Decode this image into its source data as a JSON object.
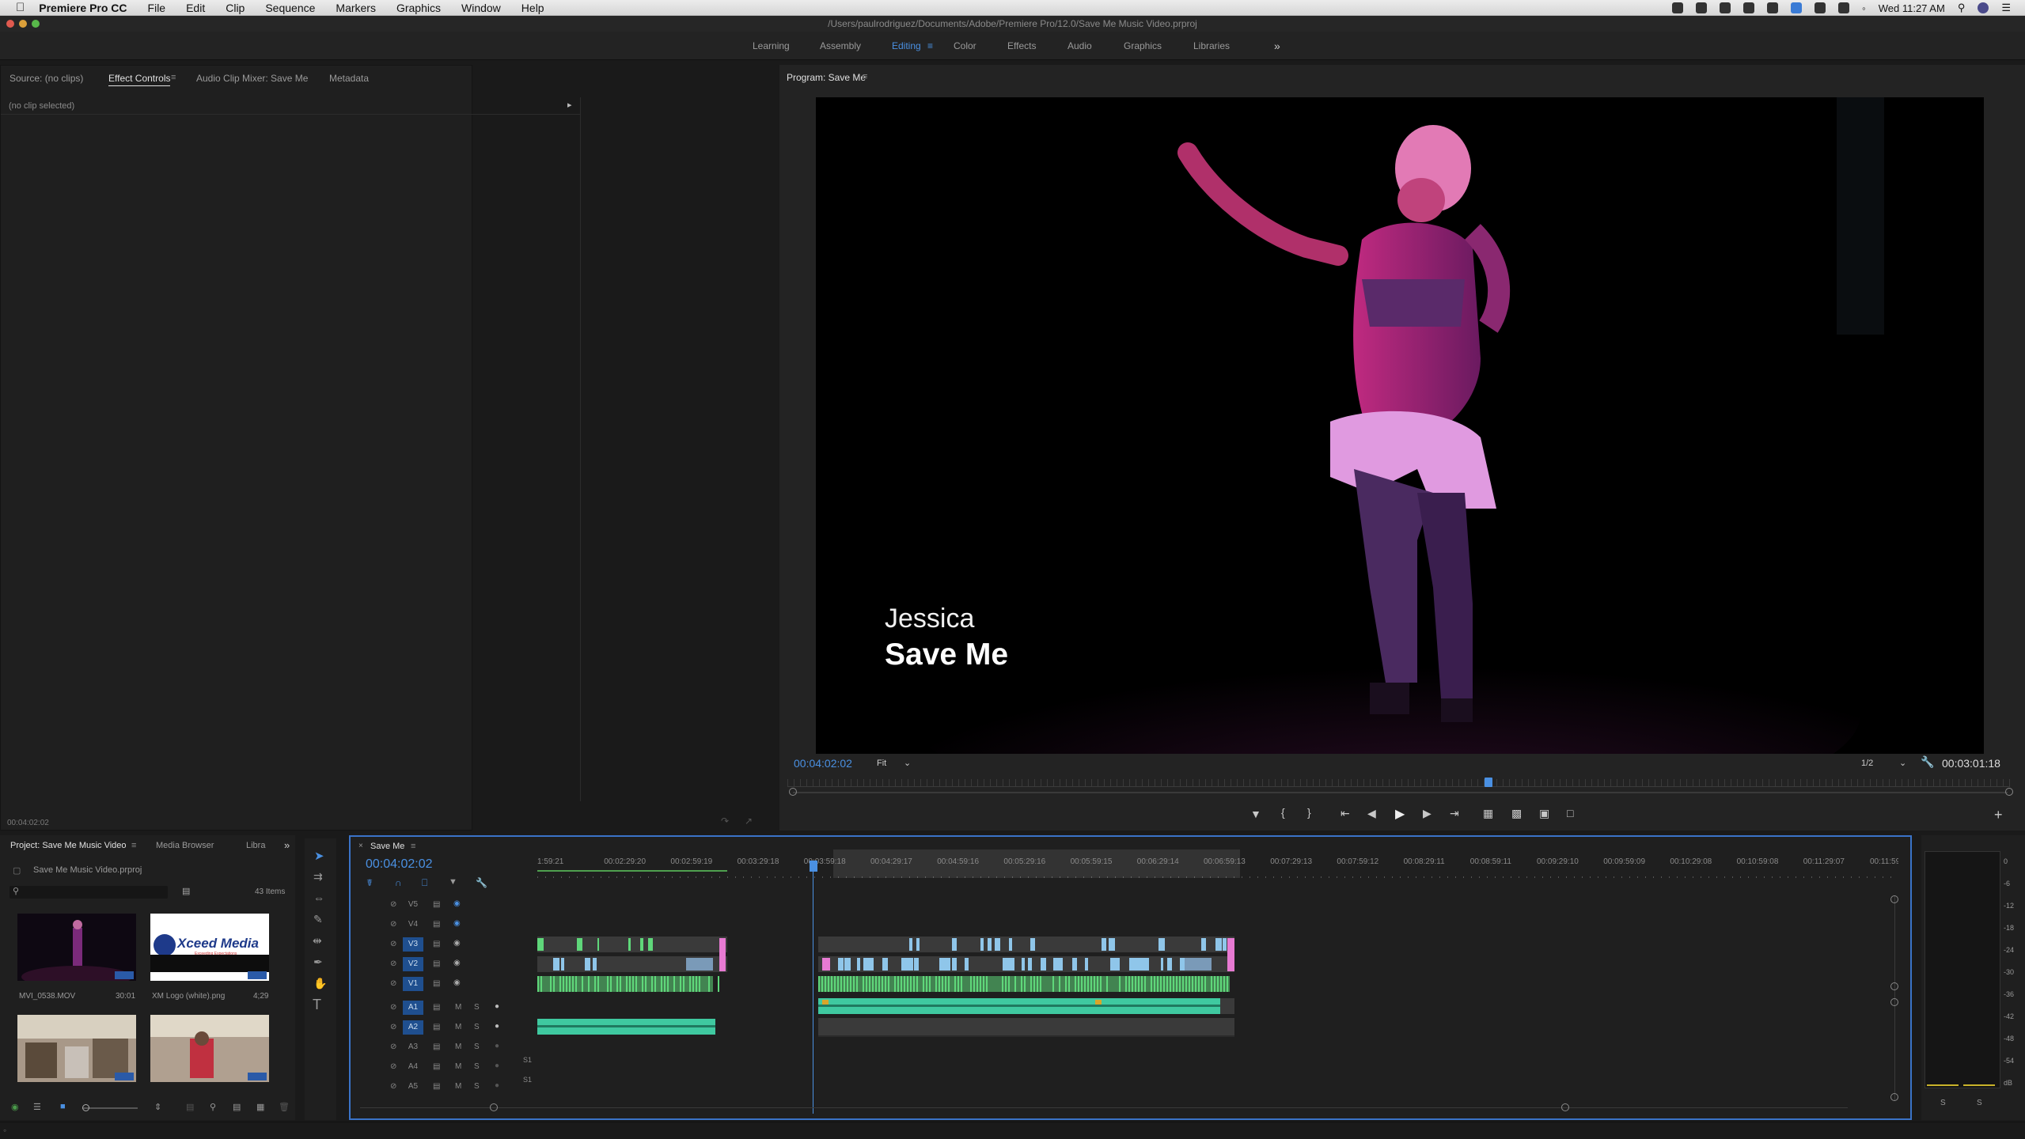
{
  "menubar": {
    "app_name": "Premiere Pro CC",
    "items": [
      "File",
      "Edit",
      "Clip",
      "Sequence",
      "Markers",
      "Graphics",
      "Window",
      "Help"
    ],
    "clock": "Wed 11:27 AM"
  },
  "window": {
    "title": "/Users/paulrodriguez/Documents/Adobe/Premiere Pro/12.0/Save Me Music Video.prproj"
  },
  "workspaces": {
    "items": [
      "Learning",
      "Assembly",
      "Editing",
      "Color",
      "Effects",
      "Audio",
      "Graphics",
      "Libraries"
    ],
    "active": "Editing",
    "overflow": "»"
  },
  "source_panel": {
    "tabs": [
      "Source: (no clips)",
      "Effect Controls",
      "Audio Clip Mixer: Save Me",
      "Metadata"
    ],
    "active_tab": "Effect Controls",
    "message": "(no clip selected)",
    "timecode": "00:04:02:02"
  },
  "program_monitor": {
    "tab": "Program: Save Me",
    "overlay_name": "Jessica",
    "overlay_title": "Save Me",
    "current_timecode": "00:04:02:02",
    "fit": "Fit",
    "resolution": "1/2",
    "duration": "00:03:01:18",
    "playhead_fraction": 0.57
  },
  "project_panel": {
    "tabs": [
      "Project: Save Me Music Video",
      "Media Browser",
      "Libra"
    ],
    "overflow": "»",
    "project_file": "Save Me Music Video.prproj",
    "item_count": "43 Items",
    "items": [
      {
        "name": "MVI_0538.MOV",
        "duration": "30:01"
      },
      {
        "name": "XM Logo (white).png",
        "duration": "4;29"
      },
      {
        "name": "",
        "duration": ""
      },
      {
        "name": "",
        "duration": ""
      }
    ],
    "logo_text": "Xceed Media",
    "logo_tagline": "Exceeding Expectations"
  },
  "timeline": {
    "tab": "Save Me",
    "timecode": "00:04:02:02",
    "ruler": [
      "1:59:21",
      "00:02:29:20",
      "00:02:59:19",
      "00:03:29:18",
      "00:03:59:18",
      "00:04:29:17",
      "00:04:59:16",
      "00:05:29:16",
      "00:05:59:15",
      "00:06:29:14",
      "00:06:59:13",
      "00:07:29:13",
      "00:07:59:12",
      "00:08:29:11",
      "00:08:59:11",
      "00:09:29:10",
      "00:09:59:09",
      "00:10:29:08",
      "00:10:59:08",
      "00:11:29:07",
      "00:11:59:"
    ],
    "video_tracks": [
      "V5",
      "V4",
      "V3",
      "V2",
      "V1"
    ],
    "audio_tracks": [
      "A1",
      "A2",
      "A3",
      "A4",
      "A5"
    ],
    "track_buttons": {
      "mute": "M",
      "solo": "S"
    },
    "submix_labels": [
      "S1",
      "S1"
    ]
  },
  "meter": {
    "scale": [
      "0",
      "-6",
      "-12",
      "-18",
      "-24",
      "-30",
      "-36",
      "-42",
      "-48",
      "-54",
      "dB"
    ],
    "solo_buttons": [
      "S",
      "S"
    ]
  },
  "colors": {
    "accent_blue": "#4a90e2",
    "clip_green": "#5fd77a",
    "clip_blue": "#8fc6ea",
    "clip_pink": "#e77ad2",
    "audio_teal": "#3fc9a0"
  }
}
